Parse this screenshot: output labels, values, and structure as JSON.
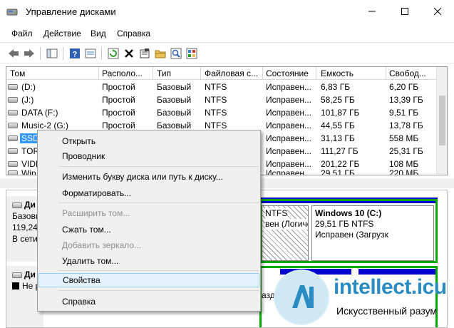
{
  "window": {
    "title": "Управление дисками",
    "icons": {
      "app": "disk-management-icon",
      "minimize": "minimize-icon",
      "maximize": "maximize-icon",
      "close": "close-icon"
    }
  },
  "menu": [
    "Файл",
    "Действие",
    "Вид",
    "Справка"
  ],
  "toolbar_icons": [
    "back-arrow-icon",
    "forward-arrow-icon",
    "console-tree-icon",
    "help-icon",
    "properties-view-icon",
    "refresh-icon",
    "delete-icon",
    "properties-icon",
    "open-folder-icon",
    "find-icon",
    "snapshot-icon"
  ],
  "list": {
    "columns": [
      "Том",
      "Располо...",
      "Тип",
      "Файловая с...",
      "Состояние",
      "Емкость",
      "Свобод..."
    ],
    "rows": [
      [
        "(D:)",
        "Простой",
        "Базовый",
        "NTFS",
        "Исправен...",
        "6,83 ГБ",
        "6,20 ГБ"
      ],
      [
        "(J:)",
        "Простой",
        "Базовый",
        "NTFS",
        "Исправен...",
        "58,25 ГБ",
        "13,39 ГБ"
      ],
      [
        "DATA (F:)",
        "Простой",
        "Базовый",
        "NTFS",
        "Исправен...",
        "101,87 ГБ",
        "9,51 ГБ"
      ],
      [
        "Music-2 (G:)",
        "Простой",
        "Базовый",
        "NTFS",
        "Исправен...",
        "44,55 ГБ",
        "13,78 ГБ"
      ],
      [
        "SSD",
        "",
        "",
        "",
        "Исправен...",
        "31,13 ГБ",
        "558 МБ"
      ],
      [
        "TOR",
        "",
        "",
        "",
        "Исправен...",
        "111,27 ГБ",
        "25,31 ГБ"
      ],
      [
        "VIDE",
        "",
        "",
        "",
        "Исправен...",
        "201,22 ГБ",
        "108 МБ"
      ],
      [
        "Win",
        "",
        "",
        "",
        "Исправен...",
        "29,51 ГБ",
        "220 МБ"
      ]
    ]
  },
  "lower": {
    "disk1": {
      "label1": "Ди",
      "label2": "Базовы",
      "label3": "119,24",
      "label4": "В сети"
    },
    "partition_mid": {
      "line1": "NTFS",
      "line2": "вен (Логиче"
    },
    "partition_win": {
      "title": "Windows 10  (C:)",
      "size": "29,51 ГБ NTFS",
      "status": "Исправен (Загрузк"
    },
    "disk2": {
      "label1": "Ди",
      "label2": "Не р"
    },
    "fragment": "азд"
  },
  "context_menu": {
    "items": [
      {
        "label": "Открыть",
        "disabled": false
      },
      {
        "label": "Проводник",
        "disabled": false
      },
      {
        "label": "Изменить букву диска или путь к диску...",
        "disabled": false
      },
      {
        "label": "Форматировать...",
        "disabled": false
      },
      {
        "label": "Расширить том...",
        "disabled": true
      },
      {
        "label": "Сжать том...",
        "disabled": false
      },
      {
        "label": "Добавить зеркало...",
        "disabled": true
      },
      {
        "label": "Удалить том...",
        "disabled": false
      },
      {
        "label": "Свойства",
        "disabled": false,
        "highlighted": true
      },
      {
        "label": "Справка",
        "disabled": false
      }
    ]
  },
  "watermark": {
    "brand": "intellect.icu",
    "tagline": "Искусственный разум"
  },
  "colors": {
    "selection": "#3399ff",
    "partition_bar": "#0000cc",
    "active_frame": "#00aa00",
    "menu_highlight": "#e5f3ff"
  }
}
